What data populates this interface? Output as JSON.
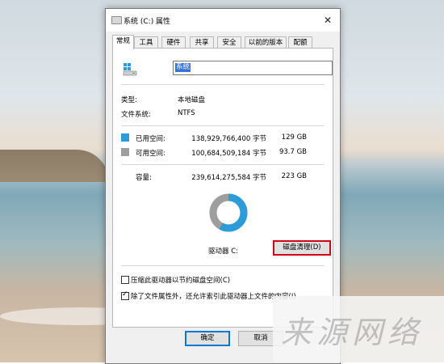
{
  "window": {
    "title": "系统 (C:) 属性",
    "close_glyph": "✕"
  },
  "tabs": [
    "常规",
    "工具",
    "硬件",
    "共享",
    "安全",
    "以前的版本",
    "配额"
  ],
  "general": {
    "drive_name": "系统",
    "type_label": "类型:",
    "type_value": "本地磁盘",
    "fs_label": "文件系统:",
    "fs_value": "NTFS",
    "used": {
      "label": "已用空间:",
      "bytes": "138,929,766,400 字节",
      "size": "129 GB",
      "color": "#2b9cd8"
    },
    "free": {
      "label": "可用空间:",
      "bytes": "100,684,509,184 字节",
      "size": "93.7 GB",
      "color": "#9e9e9e"
    },
    "capacity": {
      "label": "容量:",
      "bytes": "239,614,275,584 字节",
      "size": "223 GB"
    },
    "used_fraction": 0.58,
    "drive_label": "驱动器 C:",
    "cleanup_button": "磁盘清理(D)",
    "compress_checkbox": {
      "label": "压缩此驱动器以节约磁盘空间(C)",
      "checked": false
    },
    "index_checkbox": {
      "label": "除了文件属性外，还允许索引此驱动器上文件的内容(I)",
      "checked": true
    }
  },
  "footer": {
    "ok": "确定",
    "cancel": "取消"
  },
  "watermark": "来源网络"
}
